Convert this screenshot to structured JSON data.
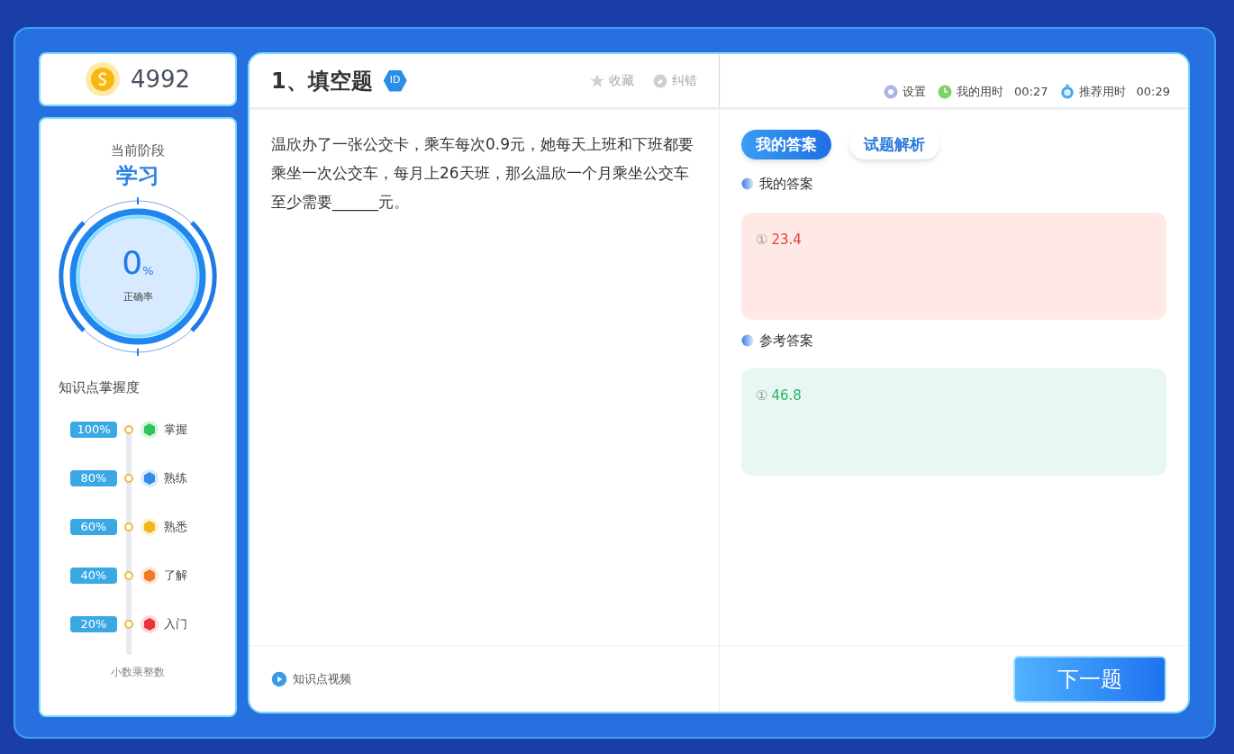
{
  "coins": "4992",
  "stage": {
    "label": "当前阶段",
    "value": "学习",
    "percent": "0",
    "percent_sign": "%",
    "rate_label": "正确率"
  },
  "mastery": {
    "title": "知识点掌握度",
    "levels": [
      {
        "percent": "100%",
        "name": "掌握",
        "color": "#2ec45a"
      },
      {
        "percent": "80%",
        "name": "熟练",
        "color": "#2f8de8"
      },
      {
        "percent": "60%",
        "name": "熟悉",
        "color": "#f0b81c"
      },
      {
        "percent": "40%",
        "name": "了解",
        "color": "#f07a2a"
      },
      {
        "percent": "20%",
        "name": "入门",
        "color": "#e8323c"
      }
    ],
    "topic": "小数乘整数"
  },
  "question": {
    "title": "1、填空题",
    "badge": "ID",
    "actions": [
      "收藏",
      "纠错"
    ],
    "text": "温欣办了一张公交卡，乘车每次0.9元，她每天上班和下班都要乘坐一次公交车，每月上26天班，那么温欣一个月乘坐公交车至少需要______元。",
    "video_link": "知识点视频"
  },
  "toolbar": {
    "settings": "设置",
    "my_time_label": "我的用时",
    "my_time": "00:27",
    "rec_time_label": "推荐用时",
    "rec_time": "00:29"
  },
  "tabs": [
    {
      "label": "我的答案",
      "selected": true
    },
    {
      "label": "试题解析",
      "selected": false
    }
  ],
  "answers": [
    {
      "heading": "我的答案",
      "kind": "wrong",
      "number": "①",
      "value": "23.4"
    },
    {
      "heading": "参考答案",
      "kind": "correct",
      "number": "①",
      "value": "46.8"
    }
  ],
  "next_button": "下一题"
}
